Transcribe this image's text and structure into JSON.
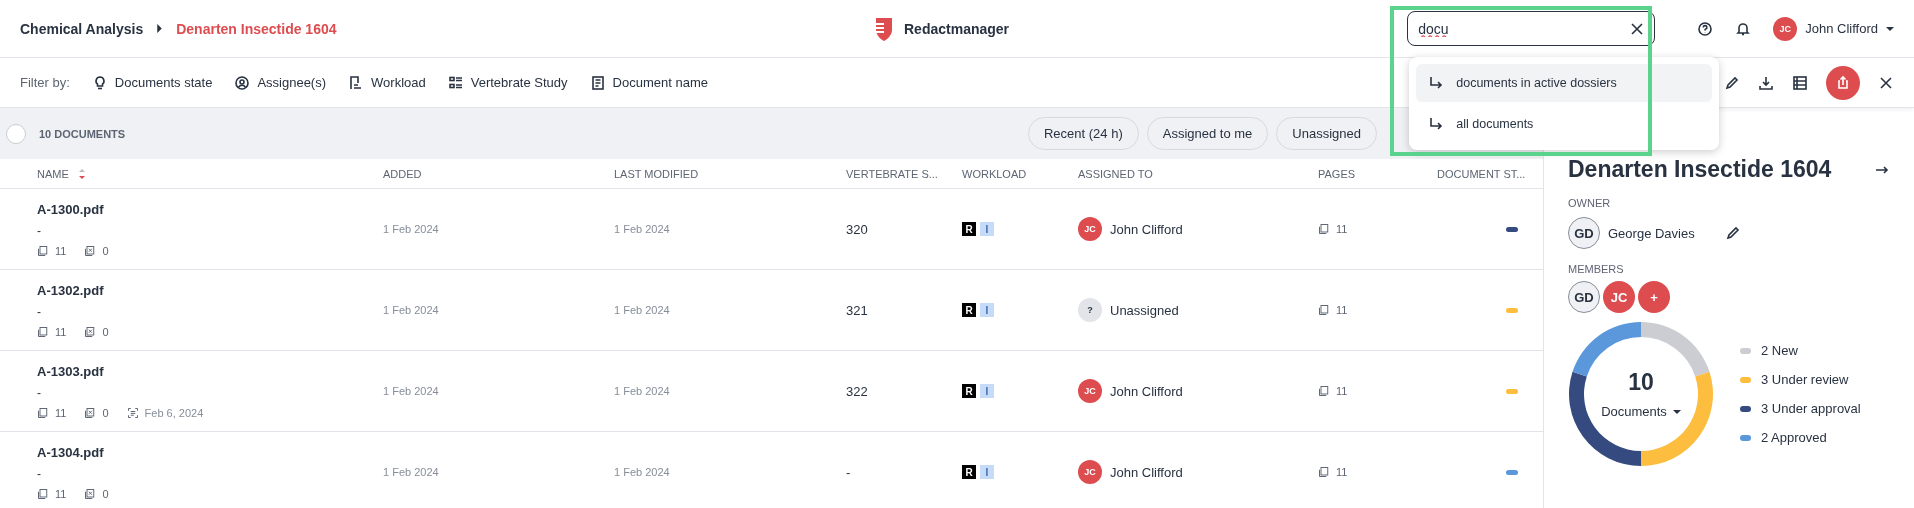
{
  "breadcrumb": [
    {
      "label": "Chemical Analysis",
      "selected": false
    },
    {
      "label": "Denarten Insectide 1604",
      "selected": true
    }
  ],
  "app_name": "Redactmanager",
  "search": {
    "value": "docu",
    "suggestions": [
      {
        "label": "documents in active dossiers",
        "selected": true
      },
      {
        "label": "all documents",
        "selected": false
      }
    ]
  },
  "user": {
    "initials": "JC",
    "name": "John Clifford"
  },
  "filter_bar": {
    "label": "Filter by:",
    "filters": [
      {
        "label": "Documents state"
      },
      {
        "label": "Assignee(s)"
      },
      {
        "label": "Workload"
      },
      {
        "label": "Vertebrate Study"
      },
      {
        "label": "Document name"
      }
    ]
  },
  "toolbar": {
    "select_all": {
      "checked": false
    },
    "count": "10 DOCUMENTS",
    "chips": [
      "Recent (24 h)",
      "Assigned to me",
      "Unassigned"
    ]
  },
  "table": {
    "columns": [
      {
        "label": "NAME",
        "sorted": true
      },
      {
        "label": "ADDED",
        "sorted": false
      },
      {
        "label": "LAST MODIFIED",
        "sorted": false
      },
      {
        "label": "VERTEBRATE S...",
        "sorted": false
      },
      {
        "label": "WORKLOAD",
        "sorted": false
      },
      {
        "label": "ASSIGNED TO",
        "sorted": false
      },
      {
        "label": "PAGES",
        "sorted": false
      },
      {
        "label": "DOCUMENT ST...",
        "sorted": false
      }
    ],
    "rows": [
      {
        "name": "A-1300.pdf",
        "note": "-",
        "pages_count": "11",
        "excluded": "0",
        "added": "1 Feb 2024",
        "modified": "1 Feb 2024",
        "vertebrate": "320",
        "workload": [
          "R",
          "I"
        ],
        "assignee": {
          "kind": "user",
          "initials": "JC",
          "name": "John Clifford"
        },
        "pages": "11",
        "color": "#354a7e"
      },
      {
        "name": "A-1302.pdf",
        "note": "-",
        "pages_count": "11",
        "excluded": "0",
        "added": "1 Feb 2024",
        "modified": "1 Feb 2024",
        "vertebrate": "321",
        "workload": [
          "R",
          "I"
        ],
        "assignee": {
          "kind": "none",
          "initials": "?",
          "name": "Unassigned"
        },
        "pages": "11",
        "color": "#fdbd3e"
      },
      {
        "name": "A-1303.pdf",
        "note": "-",
        "pages_count": "11",
        "excluded": "0",
        "ocr_date": "Feb 6, 2024",
        "added": "1 Feb 2024",
        "modified": "1 Feb 2024",
        "vertebrate": "322",
        "workload": [
          "R",
          "I"
        ],
        "assignee": {
          "kind": "user",
          "initials": "JC",
          "name": "John Clifford"
        },
        "pages": "11",
        "color": "#fdbd3e"
      },
      {
        "name": "A-1304.pdf",
        "note": "-",
        "pages_count": "11",
        "excluded": "0",
        "added": "1 Feb 2024",
        "modified": "1 Feb 2024",
        "vertebrate": "-",
        "workload": [
          "R",
          "I"
        ],
        "assignee": {
          "kind": "user",
          "initials": "JC",
          "name": "John Clifford"
        },
        "pages": "11",
        "color": "#5b97db"
      }
    ]
  },
  "panel": {
    "title": "Denarten Insectide 1604",
    "owner_label": "OWNER",
    "owner": {
      "initials": "GD",
      "name": "George Davies"
    },
    "members_label": "MEMBERS",
    "members": [
      {
        "initials": "GD",
        "kind": "gray"
      },
      {
        "initials": "JC",
        "kind": "red"
      },
      {
        "initials": "+",
        "kind": "red"
      }
    ],
    "total": "10",
    "chart_data": {
      "type": "donut",
      "categories": [
        "2 New",
        "3 Under review",
        "3 Under approval",
        "2 Approved"
      ],
      "series": [
        {
          "name": "Documents",
          "values": [
            2,
            3,
            3,
            2
          ]
        }
      ]
    },
    "slices": [
      {
        "color": "#cccdd3"
      },
      {
        "color": "#fdbd3e"
      },
      {
        "color": "#354a7e"
      },
      {
        "color": "#5b97db"
      }
    ]
  }
}
